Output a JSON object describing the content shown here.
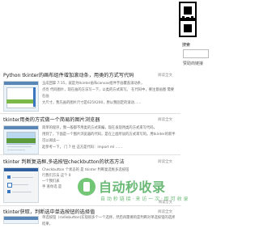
{
  "sidebar": {
    "search_label": "搜索",
    "search_placeholder": "",
    "popular_label": "赞助商链接"
  },
  "articles": [
    {
      "title": "Python tkinter的画布组件增加滚动条，用类的方式写代码",
      "meta": "阅读全文",
      "excerpt_lines": [
        "玉成回掌 7:15，就是为tkinter画布canvas组件字画覆盖滚动条，",
        "点亮 代码图片，现在画的方法写一下，以类的方式来写。 在代码中，要注意画图 需要在画",
        "大尺寸，我先画的图片尺寸是625X200，原以我固定的滚动……"
      ],
      "more": "阅读全文"
    },
    {
      "title": "tkinter用类的方式做一个简易的图片浏览器",
      "meta": "阅读全文",
      "excerpt_lines": [
        "简单的程序，我一般都不用类的方式来编，现在发现用类的方式来写代码，",
        "用到了，下面是一个图片浏览器的代码，是在上面所说的方式来写的。用tkinter的新手可以阅读一",
        "起参考一下， 门 7 往      这方是代码：import ml ……"
      ],
      "more": "阅读全文"
    },
    {
      "title": "tkinter 判断复选框,多选按钮checkbutton的状态方法",
      "meta": "阅读全文",
      "excerpt_lines": [
        "Checkbutton 个状态的 是 tkinter 判断复选框多选按钮",
        "行我们方法 这个 0",
        "",
        "一个我们表",
        "手 查你选 是"
      ],
      "more": "阅读全文"
    },
    {
      "title": "tkinter获取，判断选中单选按钮的选择值",
      "meta": "阅读全文",
      "excerpt_lines": [
        "单选按钮（radiobutton)实现很多个一个选择，然后再需要的是判断对单选按钮的选择结果，"
      ],
      "more": ""
    }
  ],
  "watermark": {
    "title": "自动秒收录",
    "subtitle": "自 动 秒 链 接 · 来 访 一 次 · 即 可 收 录"
  }
}
